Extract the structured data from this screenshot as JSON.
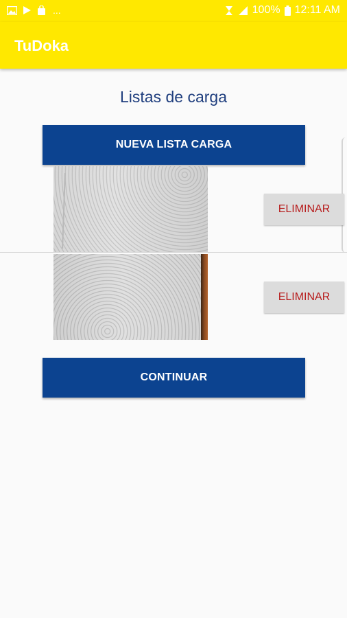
{
  "status_bar": {
    "left_icons": [
      "image-icon",
      "play-store-icon",
      "bag-icon"
    ],
    "overflow": "...",
    "battery": "100%",
    "time": "12:11 AM"
  },
  "app_bar": {
    "title": "TuDoka"
  },
  "main": {
    "page_title": "Listas de carga",
    "new_list_button": "NUEVA LISTA CARGA",
    "items": [
      {
        "delete_label": "ELIMINAR"
      },
      {
        "delete_label": "ELIMINAR"
      }
    ],
    "continue_button": "CONTINUAR"
  },
  "colors": {
    "app_bar": "#ffe800",
    "primary_button": "#0c4390",
    "title_text": "#1f3e7e",
    "delete_text": "#b71c1c",
    "delete_bg": "#dcdcdc"
  }
}
